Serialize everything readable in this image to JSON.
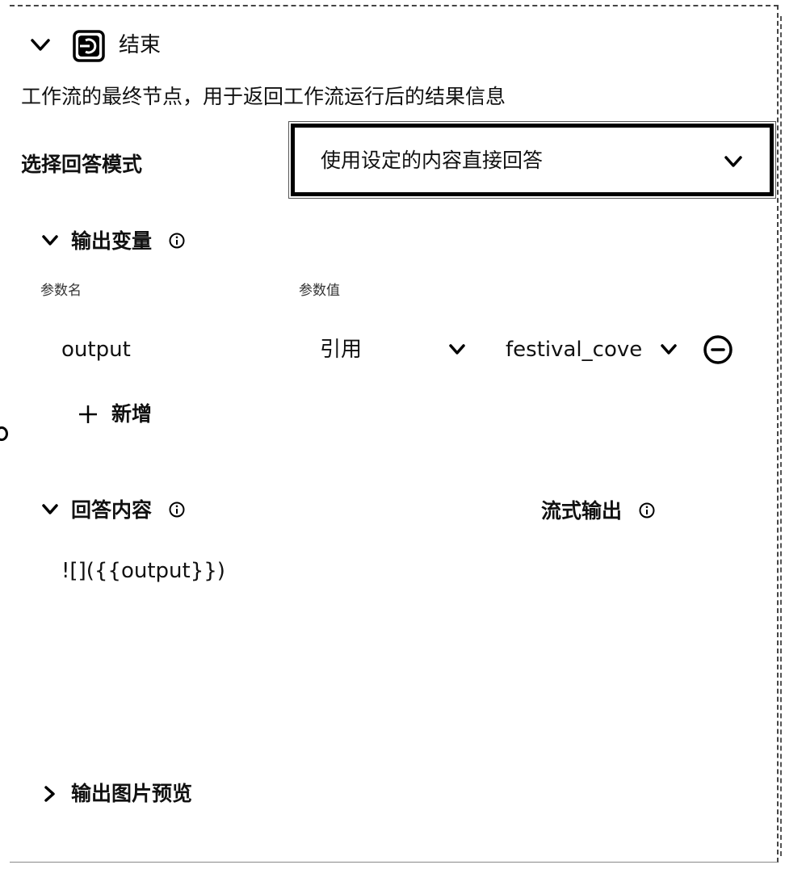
{
  "node": {
    "title": "结束",
    "icon": "end-node-icon",
    "description": "工作流的最终节点，用于返回工作流运行后的结果信息"
  },
  "answer_mode": {
    "label": "选择回答模式",
    "selected": "使用设定的内容直接回答"
  },
  "output_vars": {
    "title": "输出变量",
    "col_name": "参数名",
    "col_value": "参数值",
    "rows": [
      {
        "name": "output",
        "type": "引用",
        "reference": "festival_cove"
      }
    ],
    "add_label": "新增"
  },
  "answer_content": {
    "title": "回答内容",
    "stream_label": "流式输出",
    "content": "![]({{output}})"
  },
  "image_preview": {
    "title": "输出图片预览"
  }
}
